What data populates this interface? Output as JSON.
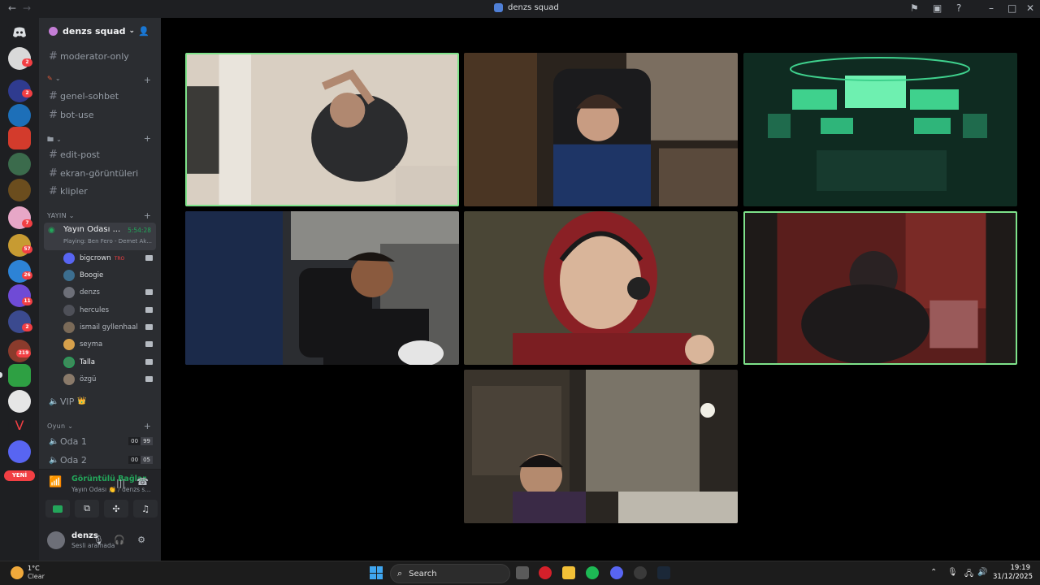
{
  "window": {
    "title": "denzs squad",
    "back": "←",
    "forward": "→"
  },
  "titlebar_icons": [
    "flag-icon",
    "inbox-icon",
    "help-icon",
    "minimize-icon",
    "maximize-icon",
    "close-icon"
  ],
  "rail": {
    "badges": [
      "2",
      "2",
      "2",
      "7",
      "57",
      "26",
      "11",
      "2",
      "219"
    ],
    "new_label": "YENİ"
  },
  "sidebar": {
    "guild_name": "denzs squad",
    "channels_top": [
      {
        "name": "moderator-only"
      }
    ],
    "cat_pen": {
      "label": "",
      "channels": [
        "genel-sohbet",
        "bot-use"
      ]
    },
    "cat_folder": {
      "label": "",
      "channels": [
        "edit-post",
        "ekran-görüntüleri",
        "klipler"
      ]
    },
    "cat_yayin": {
      "label": "YAYIN"
    },
    "voice_active": {
      "name": "Yayın Odası ...",
      "timer": "5:54:28",
      "activity": "Playing: Ben Fero - Demet Ak..."
    },
    "voice_users": [
      {
        "name": "bigcrown",
        "live": "TRO",
        "color": "#5865f2"
      },
      {
        "name": "Boogie",
        "live": "",
        "color": "#3c6e8f"
      },
      {
        "name": "denzs",
        "live": "",
        "color": "#6d6f78"
      },
      {
        "name": "hercules",
        "live": "",
        "color": "#4e5058"
      },
      {
        "name": "ismail gyllenhaal",
        "live": "",
        "color": "#7a6a58"
      },
      {
        "name": "seyma",
        "live": "",
        "color": "#d6a04b"
      },
      {
        "name": "Talla",
        "live": "",
        "color": "#3d8b5a"
      },
      {
        "name": "özgü",
        "live": "",
        "color": "#8a7a6a"
      }
    ],
    "vip_channel": "VIP",
    "cat_oyun": {
      "label": "Oyun"
    },
    "oyun_channels": [
      {
        "name": "Oda 1",
        "a": "00",
        "b": "99"
      },
      {
        "name": "Oda 2",
        "a": "00",
        "b": "05"
      }
    ]
  },
  "voice_panel": {
    "status": "Görüntülü Bağlantı Kuruldu",
    "sub": "Yayın Odası 👏 / denzs s..."
  },
  "user": {
    "name": "denzs",
    "status": "Sesli aramada"
  },
  "taskbar": {
    "temp": "1°C",
    "condition": "Clear",
    "search_placeholder": "Search",
    "time": "19:19",
    "date": "31/12/2025"
  },
  "colors": {
    "speaking": "#7ee28a",
    "online": "#23a55a",
    "badge": "#f23f43"
  }
}
